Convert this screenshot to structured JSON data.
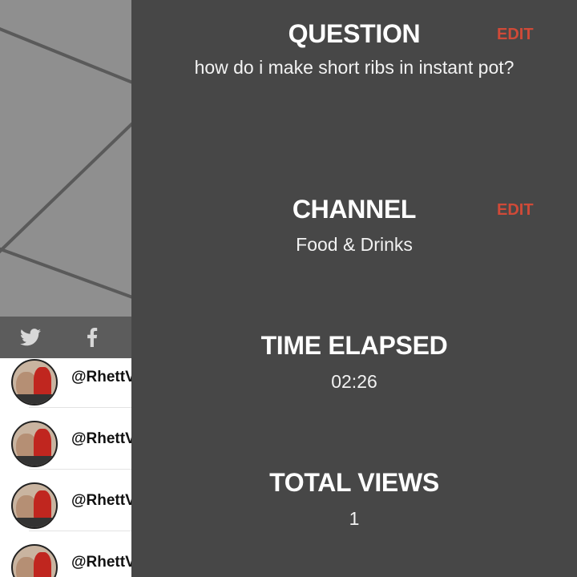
{
  "panel": {
    "question": {
      "title": "QUESTION",
      "edit_label": "EDIT",
      "value": "how do i make short ribs in instant pot?"
    },
    "channel": {
      "title": "CHANNEL",
      "edit_label": "EDIT",
      "value": "Food & Drinks"
    },
    "time_elapsed": {
      "title": "TIME ELAPSED",
      "value": "02:26"
    },
    "total_views": {
      "title": "TOTAL VIEWS",
      "value": "1"
    }
  },
  "share": {
    "icons": [
      "twitter-icon",
      "facebook-icon"
    ]
  },
  "comments": [
    {
      "user": "@RhettV"
    },
    {
      "user": "@RhettV"
    },
    {
      "user": "@RhettV"
    },
    {
      "user": "@RhettV"
    }
  ],
  "colors": {
    "panel_bg": "#474747",
    "edit_accent": "#d04a38",
    "share_bar_bg": "#5c5c5c"
  }
}
